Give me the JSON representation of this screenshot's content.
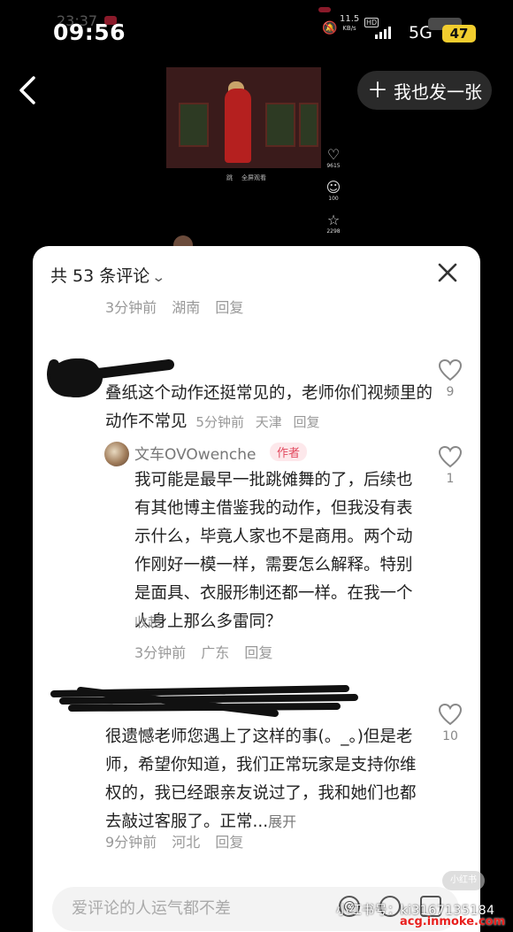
{
  "status_bar": {
    "time": "09:56",
    "ghost_time": "23:37",
    "net_speed": "11.5",
    "net_unit": "KB/s",
    "hd": "HD",
    "network": "5G",
    "battery": "47"
  },
  "nav": {
    "back_icon": "chevron-left-icon",
    "post_button": "我也发一张"
  },
  "video": {
    "sub_left": "跳",
    "sub_right": "全屏观看",
    "likes": "9615",
    "comments": "100",
    "stars": "2298"
  },
  "comments_panel": {
    "count_label": "共 53 条评论",
    "close_icon": "close-icon",
    "partial_meta": {
      "time": "3分钟前",
      "region": "湖南",
      "reply": "回复"
    },
    "comments": [
      {
        "text": "叠纸这个动作还挺常见的，老师你们视频里的动作不常见",
        "time": "5分钟前",
        "region": "天津",
        "reply": "回复",
        "likes": "9"
      },
      {
        "author": "文车OVOwenche",
        "author_tag": "作者",
        "text": "我可能是最早一批跳傩舞的了，后续也有其他博主借鉴我的动作，但我没有表示什么，毕竟人家也不是商用。两个动作刚好一模一样，需要怎么解释。特别是面具、衣服形制还都一样。在我一个人身上那么多雷同？",
        "collapse": "收起",
        "time": "3分钟前",
        "region": "广东",
        "reply": "回复",
        "likes": "1"
      },
      {
        "text": "很遗憾老师您遇上了这样的事(。_。)但是老师，希望你知道，我们正常玩家是支持你维权的，我已经跟亲友说过了，我和她们也都去敲过客服了。正常...",
        "expand": "展开",
        "time": "9分钟前",
        "region": "河北",
        "reply": "回复",
        "likes": "10"
      }
    ]
  },
  "input": {
    "placeholder": "爱评论的人运气都不差"
  },
  "watermarks": {
    "line1": "小红书号：ki3167135184",
    "line2": "acg.inmoke.com",
    "pill": "小红书"
  }
}
